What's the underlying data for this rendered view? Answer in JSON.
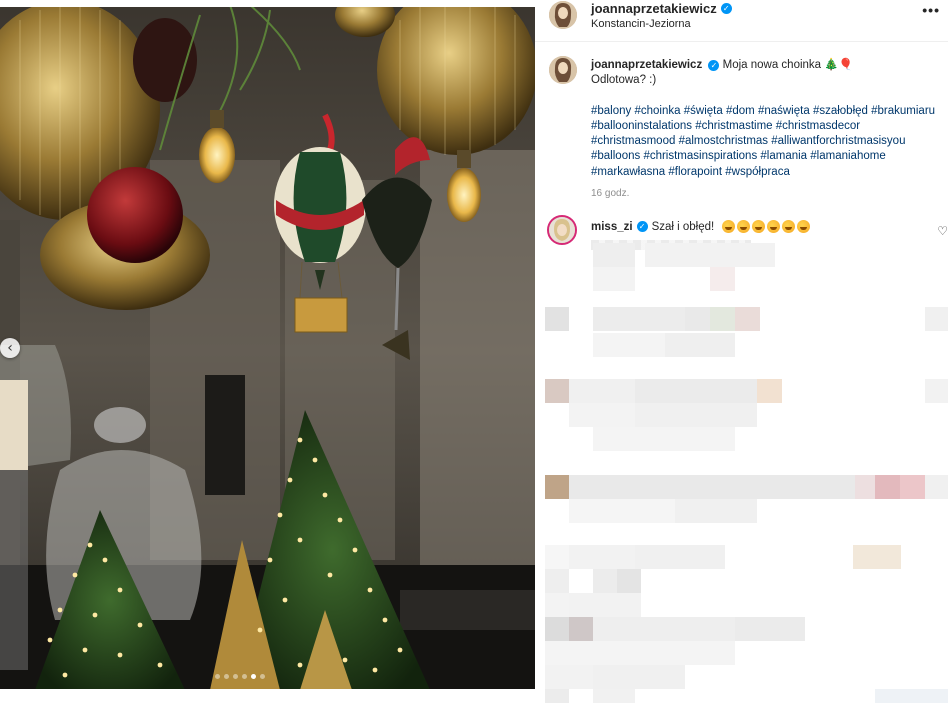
{
  "post": {
    "username": "joannaprzetakiewicz",
    "location": "Konstancin-Jeziorna",
    "more_label": "•••"
  },
  "caption": {
    "username": "joannaprzetakiewicz",
    "text_line1": "Moja nowa choinka 🎄🎈",
    "text_line2": "Odlotowa? :)",
    "hashtags": [
      "#balony",
      "#choinka",
      "#święta",
      "#dom",
      "#naświęta",
      "#szałobłęd",
      "#brakumiaru",
      "#ballooninstalations",
      "#christmastime",
      "#christmasdecor",
      "#christmasmood",
      "#almostchristmas",
      "#alliwantforchristmasisyou",
      "#balloons",
      "#christmasinspirations",
      "#lamania",
      "#lamaniahome",
      "#markawłasna",
      "#florapoint",
      "#współpraca"
    ],
    "time": "16 godz."
  },
  "comment": {
    "username": "miss_zi",
    "text": "Szał i obłęd!",
    "emoji_count": 6,
    "like_icon": "heart-outline-icon"
  },
  "icons": {
    "verified": "verified-badge-icon",
    "prev": "chevron-left-icon",
    "heart": "heart-outline-icon"
  },
  "carousel": {
    "prev_label": "‹",
    "dots": 6,
    "active_dot": 4
  },
  "colors": {
    "hashtag": "#00376b",
    "verified": "#0095f6",
    "muted": "#8e8e8e"
  }
}
